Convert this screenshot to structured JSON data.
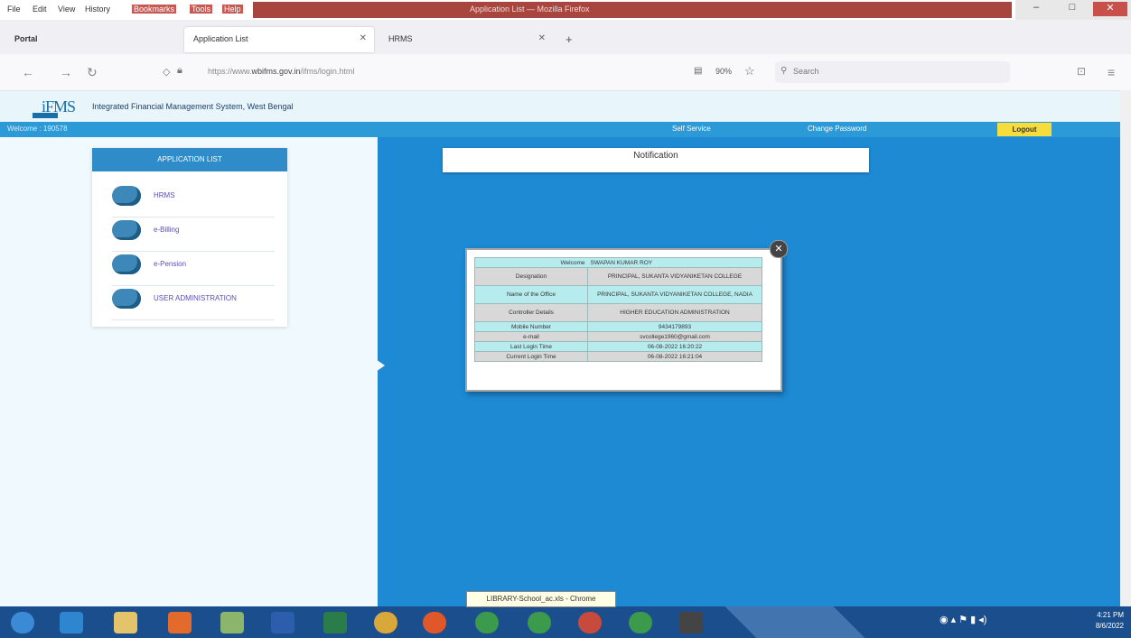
{
  "browser": {
    "menu": [
      "File",
      "Edit",
      "View",
      "History",
      "Bookmarks",
      "Tools",
      "Help"
    ],
    "window_title": "Application List — Mozilla Firefox",
    "window_buttons": [
      "–",
      "□",
      "✕"
    ],
    "tabs": [
      {
        "label": "Portal",
        "active": false
      },
      {
        "label": "Application List",
        "active": true
      },
      {
        "label": "HRMS",
        "active": false
      }
    ],
    "new_tab": "+",
    "url_prefix": "https://www.",
    "url_host": "wbifms.gov.in",
    "url_path": "/ifms/login.html",
    "zoom": "90%",
    "search_placeholder": "Search",
    "nav": {
      "back": "←",
      "forward": "→",
      "reload": "↻",
      "menu": "≡",
      "pocket": "⊡"
    }
  },
  "app": {
    "logo_text": "iFMS",
    "title": "Integrated Financial Management System, West Bengal",
    "welcome": "Welcome : 190578",
    "links": {
      "self_service": "Self Service",
      "change_password": "Change Password",
      "logout": "Logout"
    }
  },
  "sidebar": {
    "heading": "APPLICATION LIST",
    "items": [
      {
        "label": "HRMS"
      },
      {
        "label": "e-Billing"
      },
      {
        "label": "e-Pension"
      },
      {
        "label": "USER ADMINISTRATION"
      }
    ]
  },
  "notification": {
    "title": "Notification"
  },
  "popup": {
    "close": "✕",
    "welcome_label": "Welcome",
    "welcome_name": "SWAPAN KUMAR ROY",
    "rows": [
      {
        "key": "Designation",
        "value": "PRINCIPAL, SUKANTA VIDYANIKETAN COLLEGE"
      },
      {
        "key": "Name of the Office",
        "value": "PRINCIPAL, SUKANTA VIDYANIKETAN COLLEGE, NADIA"
      },
      {
        "key": "Controller Details",
        "value": "HIGHER EDUCATION ADMINISTRATION"
      },
      {
        "key": "Mobile Number",
        "value": "9434179893"
      },
      {
        "key": "e-mail",
        "value": "svcollege1960@gmail.com"
      },
      {
        "key": "Last Login Time",
        "value": "06-08-2022 16:20:22"
      },
      {
        "key": "Current Login Time",
        "value": "06-08-2022 16:21:04"
      }
    ]
  },
  "taskbar": {
    "tooltip": "LIBRARY-School_ac.xls - Chrome",
    "clock_time": "4:21 PM",
    "clock_date": "8/6/2022"
  }
}
